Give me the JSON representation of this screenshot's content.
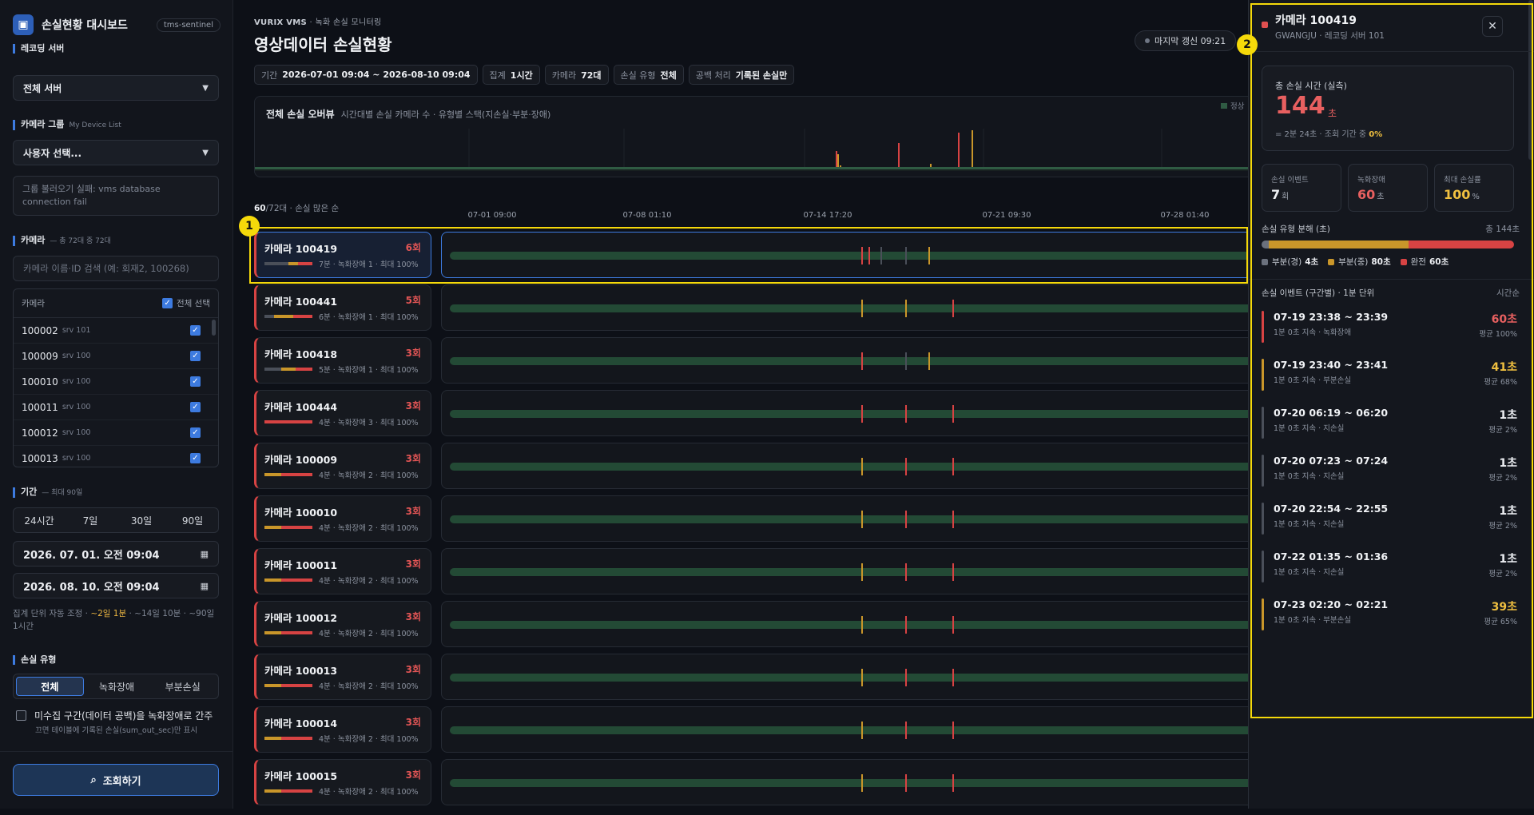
{
  "sidebar": {
    "brand_title": "손실현황 대시보드",
    "tenant_tag": "tms-sentinel",
    "recording_server_label": "레코딩 서버",
    "recording_server_value": "전체 서버",
    "camera_group_label": "카메라 그룹",
    "camera_group_sub": "My Device List",
    "camera_group_value": "사용자 선택...",
    "group_error": "그룹 불러오기 실패: vms database connection fail",
    "camera_label": "카메라",
    "camera_sub": "— 총 72대 중 72대",
    "camera_search_placeholder": "카메라 이름·ID 검색 (예: 회재2, 100268)",
    "camera_col_header": "카메라",
    "select_all_label": "전체 선택",
    "cameras": [
      {
        "id": "100002",
        "srv": "srv 101"
      },
      {
        "id": "100009",
        "srv": "srv 100"
      },
      {
        "id": "100010",
        "srv": "srv 100"
      },
      {
        "id": "100011",
        "srv": "srv 100"
      },
      {
        "id": "100012",
        "srv": "srv 100"
      },
      {
        "id": "100013",
        "srv": "srv 100"
      }
    ],
    "period_label": "기간",
    "period_sub": "— 최대 90일",
    "period_options": [
      "24시간",
      "7일",
      "30일",
      "90일"
    ],
    "date_from": "2026. 07. 01. 오전 09:04",
    "date_to": "2026. 08. 10. 오전 09:04",
    "agg_note_prefix": "집계 단위 자동 조정 · ",
    "agg_note_highlight": "~2일 1분",
    "agg_note_suffix": " · ~14일 10분 · ~90일 1시간",
    "loss_type_label": "손실 유형",
    "loss_types": [
      "전체",
      "녹화장애",
      "부분손실"
    ],
    "gap_checkbox_label": "미수집 구간(데이터 공백)을 녹화장애로 간주",
    "gap_note": "끄면 테이블에 기록된 손실(sum_out_sec)만 표시",
    "query_button": "조회하기"
  },
  "header": {
    "breadcrumb_brand": "VURIX VMS",
    "breadcrumb_rest": " · 녹화 손실 모니터링",
    "title": "영상데이터 손실현황",
    "last_refresh": "마지막 갱신 09:21",
    "chips": [
      {
        "label": "기간",
        "value": "2026-07-01 09:04 ~ 2026-08-10 09:04"
      },
      {
        "label": "집계",
        "value": "1시간"
      },
      {
        "label": "카메라",
        "value": "72대"
      },
      {
        "label": "손실 유형",
        "value": "전체"
      },
      {
        "label": "공백 처리",
        "value": "기록된 손실만"
      }
    ]
  },
  "overview": {
    "title": "전체 손실 오버뷰",
    "subtitle": "시간대별 손실 카메라 수 · 유형별 스택(지손실·부분·장애)",
    "legend_label": "정상"
  },
  "list": {
    "count_shown": "60",
    "count_total_suffix": "/72대 · 손실 많은 순",
    "ticks": [
      "07-01 09:00",
      "07-08 01:10",
      "07-14 17:20",
      "07-21 09:30",
      "07-28 01:40"
    ]
  },
  "rows": [
    {
      "name": "카메라 100419",
      "count": "6회",
      "meta": "7분 · 녹화장애 1 · 최대 100%",
      "mini": [
        [
          "#4a4f59",
          0.5
        ],
        [
          "#c9962a",
          0.2
        ],
        [
          "#d74343",
          0.3
        ]
      ],
      "marks": [
        [
          0.505,
          "#d74343"
        ],
        [
          0.513,
          "#d74343"
        ],
        [
          0.528,
          "#4a4f59"
        ],
        [
          0.558,
          "#4a4f59"
        ],
        [
          0.586,
          "#c9962a"
        ]
      ]
    },
    {
      "name": "카메라 100441",
      "count": "5회",
      "meta": "6분 · 녹화장애 1 · 최대 100%",
      "mini": [
        [
          "#4a4f59",
          0.2
        ],
        [
          "#c9962a",
          0.4
        ],
        [
          "#d74343",
          0.4
        ]
      ],
      "marks": [
        [
          0.505,
          "#c9962a"
        ],
        [
          0.558,
          "#c9962a"
        ],
        [
          0.614,
          "#d74343"
        ]
      ]
    },
    {
      "name": "카메라 100418",
      "count": "3회",
      "meta": "5분 · 녹화장애 1 · 최대 100%",
      "mini": [
        [
          "#4a4f59",
          0.35
        ],
        [
          "#c9962a",
          0.3
        ],
        [
          "#d74343",
          0.35
        ]
      ],
      "marks": [
        [
          0.505,
          "#d74343"
        ],
        [
          0.558,
          "#4a4f59"
        ],
        [
          0.586,
          "#c9962a"
        ]
      ]
    },
    {
      "name": "카메라 100444",
      "count": "3회",
      "meta": "4분 · 녹화장애 3 · 최대 100%",
      "mini": [
        [
          "#d74343",
          1
        ]
      ],
      "marks": [
        [
          0.505,
          "#d74343"
        ],
        [
          0.558,
          "#d74343"
        ],
        [
          0.614,
          "#d74343"
        ]
      ]
    },
    {
      "name": "카메라 100009",
      "count": "3회",
      "meta": "4분 · 녹화장애 2 · 최대 100%",
      "mini": [
        [
          "#c9962a",
          0.35
        ],
        [
          "#d74343",
          0.65
        ]
      ],
      "marks": [
        [
          0.505,
          "#c9962a"
        ],
        [
          0.558,
          "#d74343"
        ],
        [
          0.614,
          "#d74343"
        ]
      ]
    },
    {
      "name": "카메라 100010",
      "count": "3회",
      "meta": "4분 · 녹화장애 2 · 최대 100%",
      "mini": [
        [
          "#c9962a",
          0.35
        ],
        [
          "#d74343",
          0.65
        ]
      ],
      "marks": [
        [
          0.505,
          "#c9962a"
        ],
        [
          0.558,
          "#d74343"
        ],
        [
          0.614,
          "#d74343"
        ]
      ]
    },
    {
      "name": "카메라 100011",
      "count": "3회",
      "meta": "4분 · 녹화장애 2 · 최대 100%",
      "mini": [
        [
          "#c9962a",
          0.35
        ],
        [
          "#d74343",
          0.65
        ]
      ],
      "marks": [
        [
          0.505,
          "#c9962a"
        ],
        [
          0.558,
          "#d74343"
        ],
        [
          0.614,
          "#d74343"
        ]
      ]
    },
    {
      "name": "카메라 100012",
      "count": "3회",
      "meta": "4분 · 녹화장애 2 · 최대 100%",
      "mini": [
        [
          "#c9962a",
          0.35
        ],
        [
          "#d74343",
          0.65
        ]
      ],
      "marks": [
        [
          0.505,
          "#c9962a"
        ],
        [
          0.558,
          "#d74343"
        ],
        [
          0.614,
          "#d74343"
        ]
      ]
    },
    {
      "name": "카메라 100013",
      "count": "3회",
      "meta": "4분 · 녹화장애 2 · 최대 100%",
      "mini": [
        [
          "#c9962a",
          0.35
        ],
        [
          "#d74343",
          0.65
        ]
      ],
      "marks": [
        [
          0.505,
          "#c9962a"
        ],
        [
          0.558,
          "#d74343"
        ],
        [
          0.614,
          "#d74343"
        ]
      ]
    },
    {
      "name": "카메라 100014",
      "count": "3회",
      "meta": "4분 · 녹화장애 2 · 최대 100%",
      "mini": [
        [
          "#c9962a",
          0.35
        ],
        [
          "#d74343",
          0.65
        ]
      ],
      "marks": [
        [
          0.505,
          "#c9962a"
        ],
        [
          0.558,
          "#d74343"
        ],
        [
          0.614,
          "#d74343"
        ]
      ]
    },
    {
      "name": "카메라 100015",
      "count": "3회",
      "meta": "4분 · 녹화장애 2 · 최대 100%",
      "mini": [
        [
          "#c9962a",
          0.35
        ],
        [
          "#d74343",
          0.65
        ]
      ],
      "marks": [
        [
          0.505,
          "#c9962a"
        ],
        [
          0.558,
          "#d74343"
        ],
        [
          0.614,
          "#d74343"
        ]
      ]
    }
  ],
  "annotations": [
    "1",
    "2"
  ],
  "panel": {
    "title": "카메라 100419",
    "subtitle": "GWANGJU · 레코딩 서버 101",
    "close_icon": "✕",
    "total_label": "총 손실 시간 (실측)",
    "total_value": "144",
    "total_unit": "초",
    "total_note_prefix": "= 2분 24초 · 조회 기간 중 ",
    "total_note_pct": "0%",
    "stats": [
      {
        "label": "손실 이벤트",
        "value": "7",
        "unit": "회",
        "color": "#f1f3f6"
      },
      {
        "label": "녹화장애",
        "value": "60",
        "unit": "초",
        "color": "#e86060"
      },
      {
        "label": "최대 손실률",
        "value": "100",
        "unit": "%",
        "color": "#f0c040"
      }
    ],
    "breakdown_label": "손실 유형 분해 (초)",
    "breakdown_total": "총 144초",
    "breakdown": [
      {
        "name": "부분(경)",
        "value": "4초",
        "sec": 4,
        "color": "#6b717d"
      },
      {
        "name": "부분(중)",
        "value": "80초",
        "sec": 80,
        "color": "#c9962a"
      },
      {
        "name": "완전",
        "value": "60초",
        "sec": 60,
        "color": "#d74343"
      }
    ],
    "events_label": "손실 이벤트 (구간별) · 1분 단위",
    "events_sort": "시간순",
    "events": [
      {
        "time": "07-19 23:38 ~ 23:39",
        "desc": "1분 0초 지속 · 녹화장애",
        "value": "60초",
        "avg": "평균 100%",
        "color": "#d74343"
      },
      {
        "time": "07-19 23:40 ~ 23:41",
        "desc": "1분 0초 지속 · 부분손실",
        "value": "41초",
        "avg": "평균 68%",
        "color": "#c9962a"
      },
      {
        "time": "07-20 06:19 ~ 06:20",
        "desc": "1분 0초 지속 · 지손실",
        "value": "1초",
        "avg": "평균 2%",
        "color": "#4a4f59"
      },
      {
        "time": "07-20 07:23 ~ 07:24",
        "desc": "1분 0초 지속 · 지손실",
        "value": "1초",
        "avg": "평균 2%",
        "color": "#4a4f59"
      },
      {
        "time": "07-20 22:54 ~ 22:55",
        "desc": "1분 0초 지속 · 지손실",
        "value": "1초",
        "avg": "평균 2%",
        "color": "#4a4f59"
      },
      {
        "time": "07-22 01:35 ~ 01:36",
        "desc": "1분 0초 지속 · 지손실",
        "value": "1초",
        "avg": "평균 2%",
        "color": "#4a4f59"
      },
      {
        "time": "07-23 02:20 ~ 02:21",
        "desc": "1분 0초 지속 · 부분손실",
        "value": "39초",
        "avg": "평균 65%",
        "color": "#c9962a"
      }
    ]
  }
}
